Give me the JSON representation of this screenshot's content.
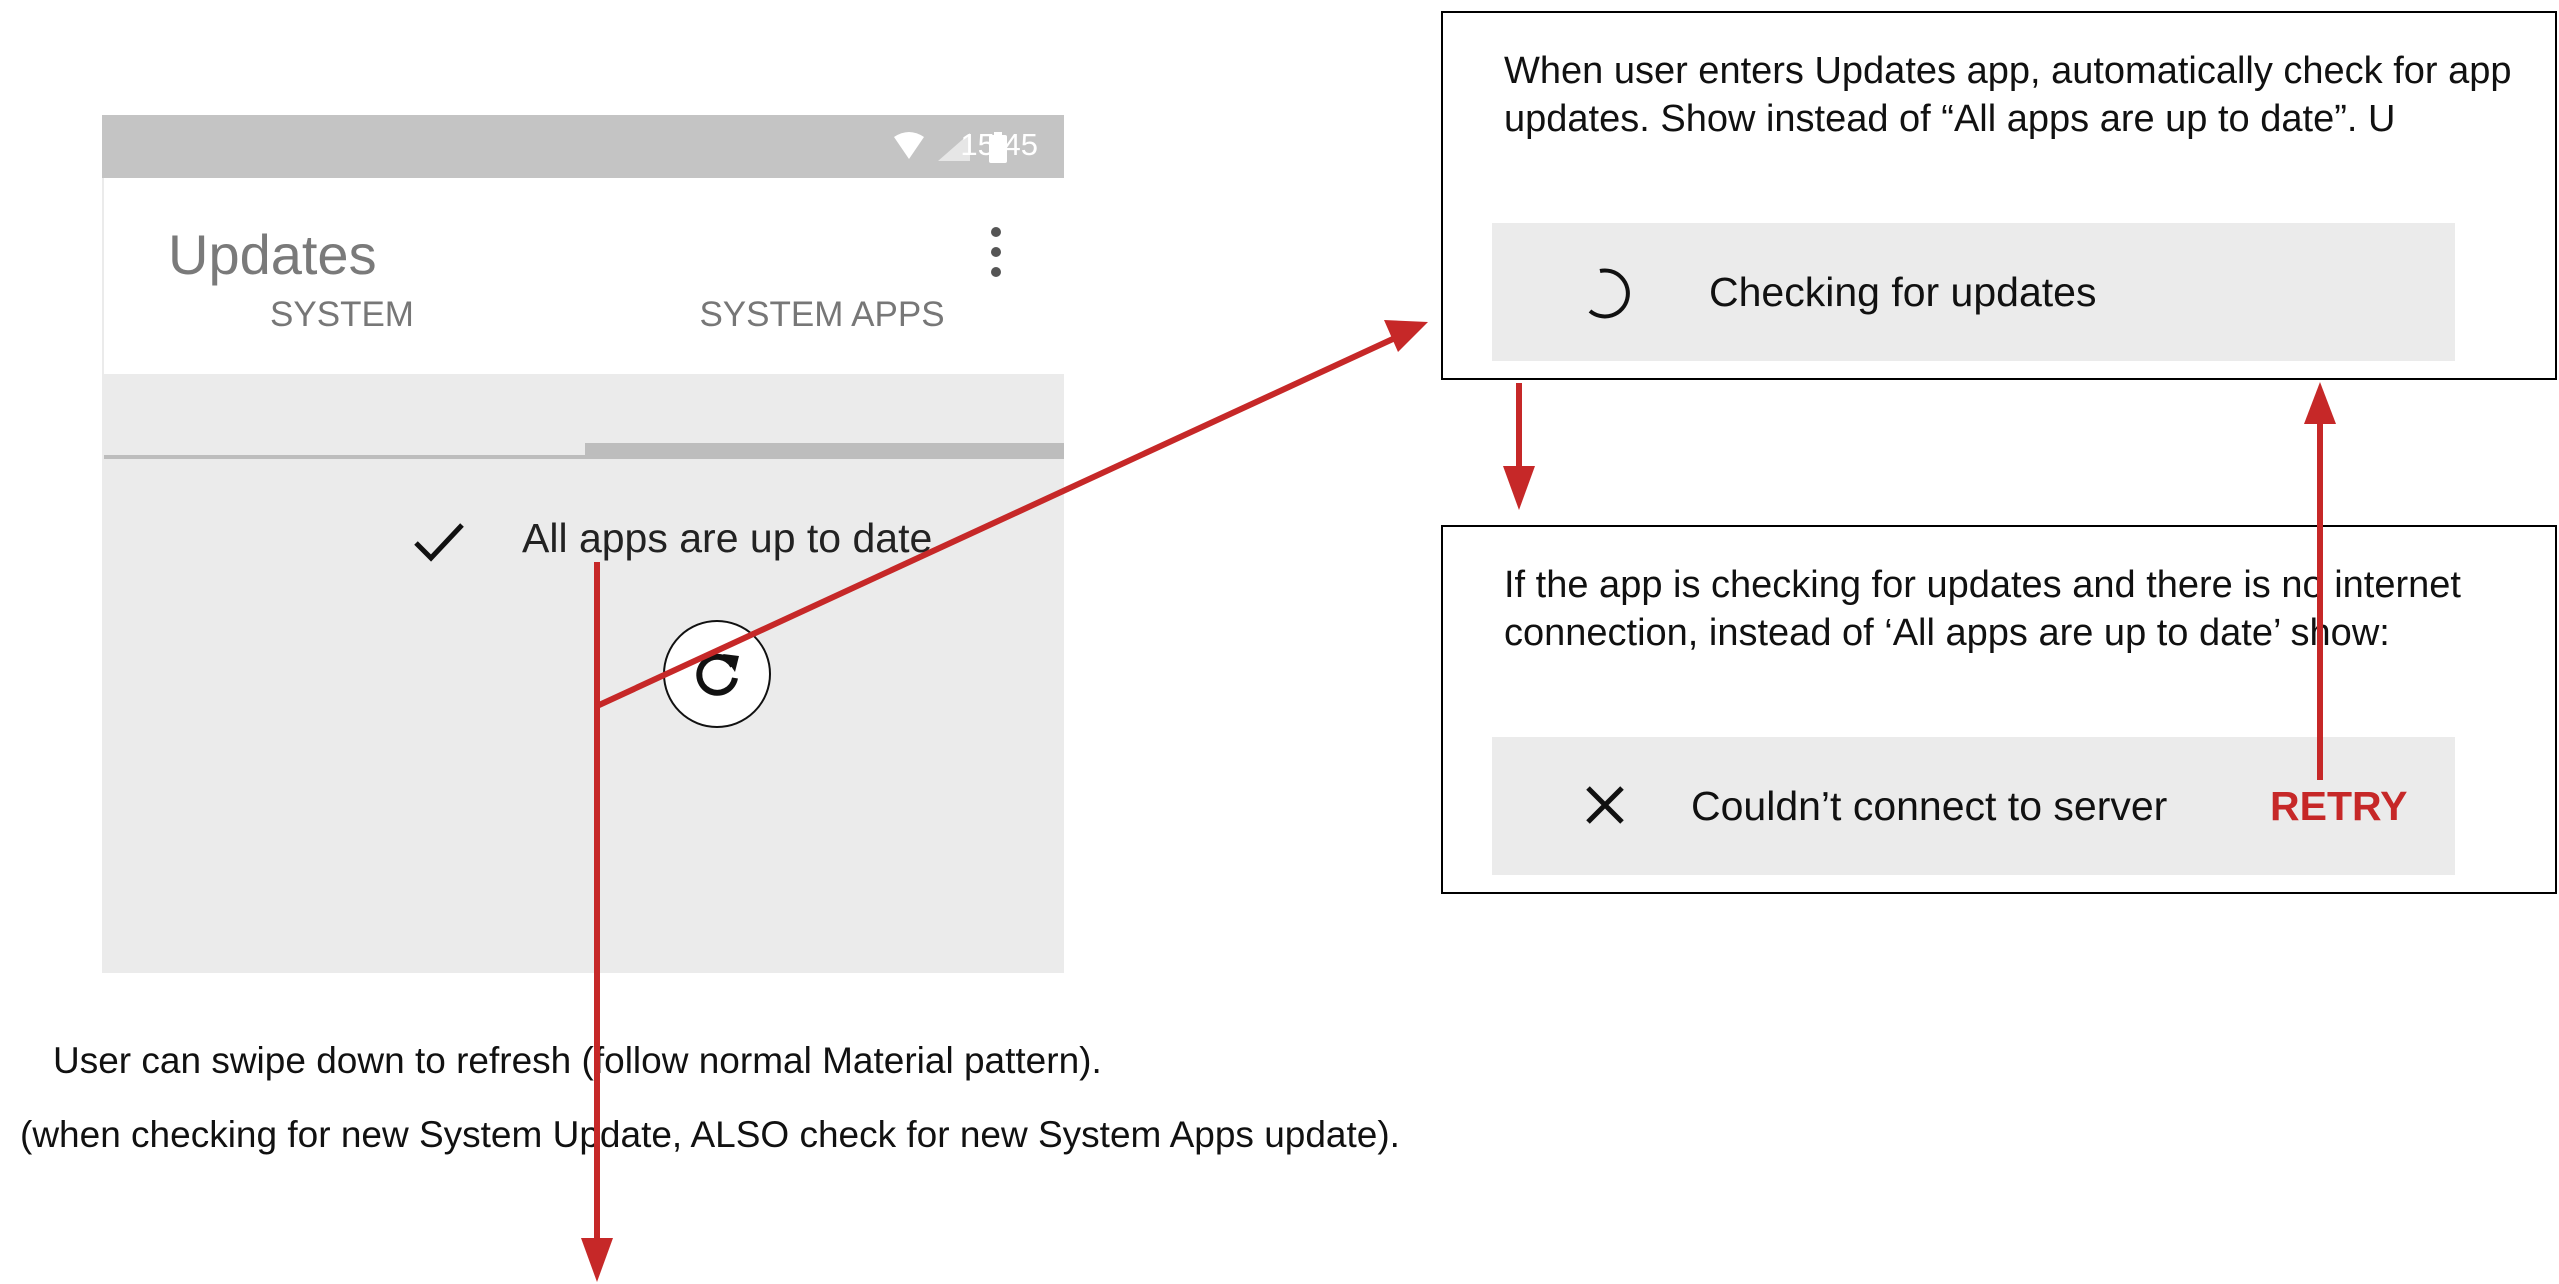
{
  "phone": {
    "status_time": "15:45",
    "app_title": "Updates",
    "tabs": [
      {
        "label": "SYSTEM"
      },
      {
        "label": "SYSTEM APPS"
      }
    ],
    "status_message": "All apps are up to date"
  },
  "notes": {
    "auto_check": {
      "text": "When user enters Updates app, automatically check for app updates. Show instead of “All apps are up to date”. U",
      "banner_label": "Checking for updates"
    },
    "no_connection": {
      "text": "If the app is checking for updates and there is no internet connection, instead of ‘All apps are up to date’ show:",
      "banner_label": "Couldn’t connect to server",
      "retry_label": "RETRY"
    }
  },
  "footnotes": {
    "swipe": "User can swipe down to refresh (follow normal Material pattern).",
    "also_check": "(when checking for new System Update, ALSO check for new System Apps update)."
  },
  "colors": {
    "accent_red": "#c62828",
    "status_bar": "#c4c4c4",
    "surface_gray": "#ebebeb"
  }
}
